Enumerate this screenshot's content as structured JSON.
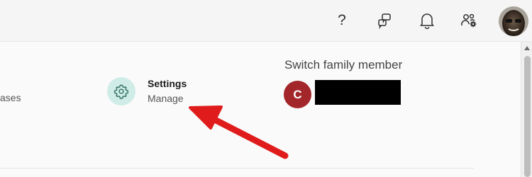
{
  "header": {
    "help_glyph": "?",
    "icons": [
      "help-icon",
      "feedback-icon",
      "bell-icon",
      "family-settings-icon",
      "profile-avatar"
    ]
  },
  "main": {
    "purchases_tail": "ases",
    "settings": {
      "title": "Settings",
      "subtitle": "Manage"
    },
    "switch_member": {
      "title": "Switch family member",
      "avatar_initial": "C"
    }
  },
  "colors": {
    "settings_circle": "#cfece6",
    "member_avatar": "#a3262a",
    "annotation_arrow": "#e01b1b"
  }
}
